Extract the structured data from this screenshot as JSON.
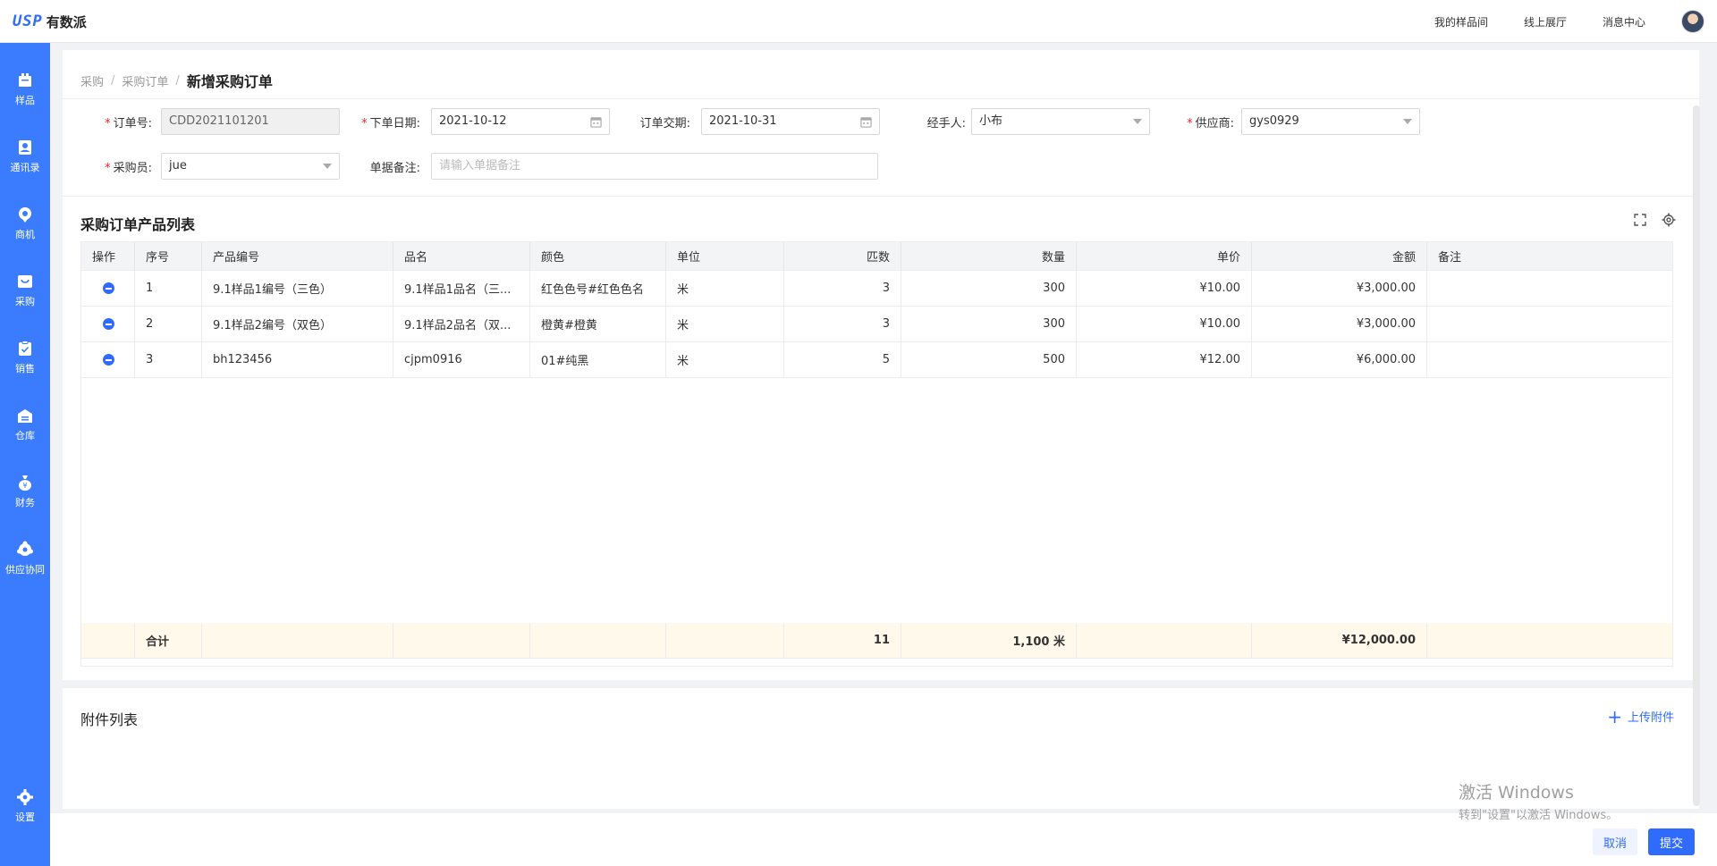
{
  "app": {
    "logo_mark": "USP",
    "logo_text": "有数派"
  },
  "topnav": {
    "items": [
      "我的样品间",
      "线上展厅",
      "消息中心"
    ]
  },
  "sidebar": {
    "items": [
      {
        "label": "样品",
        "icon": "sample-icon"
      },
      {
        "label": "通讯录",
        "icon": "contacts-icon"
      },
      {
        "label": "商机",
        "icon": "opportunity-icon"
      },
      {
        "label": "采购",
        "icon": "purchase-icon"
      },
      {
        "label": "销售",
        "icon": "sales-icon"
      },
      {
        "label": "仓库",
        "icon": "warehouse-icon"
      },
      {
        "label": "财务",
        "icon": "finance-icon"
      },
      {
        "label": "供应协同",
        "icon": "supply-icon"
      }
    ],
    "settings_label": "设置"
  },
  "breadcrumb": {
    "level1": "采购",
    "level2": "采购订单",
    "current": "新增采购订单"
  },
  "form": {
    "order_no": {
      "label": "订单号:",
      "value": "CDD2021101201"
    },
    "order_date": {
      "label": "下单日期:",
      "value": "2021-10-12"
    },
    "delivery_date": {
      "label": "订单交期:",
      "value": "2021-10-31"
    },
    "handler": {
      "label": "经手人:",
      "value": "小布"
    },
    "supplier": {
      "label": "供应商:",
      "value": "gys0929"
    },
    "buyer": {
      "label": "采购员:",
      "value": "jue"
    },
    "remark": {
      "label": "单据备注:",
      "placeholder": "请输入单据备注"
    }
  },
  "product_table": {
    "title": "采购订单产品列表",
    "columns": [
      "操作",
      "序号",
      "产品编号",
      "品名",
      "颜色",
      "单位",
      "匹数",
      "数量",
      "单价",
      "金额",
      "备注"
    ],
    "rows": [
      {
        "seq": "1",
        "code": "9.1样品1编号（三色）",
        "name": "9.1样品1品名（三...",
        "color": "红色色号#红色色名",
        "unit": "米",
        "pieces": "3",
        "qty": "300",
        "price": "¥10.00",
        "amount": "¥3,000.00",
        "remark": ""
      },
      {
        "seq": "2",
        "code": "9.1样品2编号（双色）",
        "name": "9.1样品2品名（双...",
        "color": "橙黄#橙黄",
        "unit": "米",
        "pieces": "3",
        "qty": "300",
        "price": "¥10.00",
        "amount": "¥3,000.00",
        "remark": ""
      },
      {
        "seq": "3",
        "code": "bh123456",
        "name": "cjpm0916",
        "color": "01#纯黑",
        "unit": "米",
        "pieces": "5",
        "qty": "500",
        "price": "¥12.00",
        "amount": "¥6,000.00",
        "remark": ""
      }
    ],
    "total": {
      "label": "合计",
      "pieces": "11",
      "qty": "1,100 米",
      "amount": "¥12,000.00"
    }
  },
  "attachments": {
    "title": "附件列表",
    "upload_label": "上传附件"
  },
  "actions": {
    "cancel": "取消",
    "submit": "提交"
  },
  "watermark": {
    "line1": "激活 Windows",
    "line2": "转到\"设置\"以激活 Windows。"
  }
}
